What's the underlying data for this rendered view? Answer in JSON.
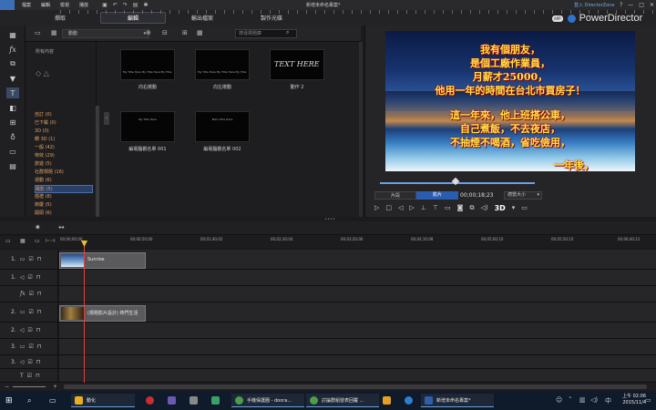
{
  "window": {
    "menu": [
      "檔案",
      "編輯",
      "檢視",
      "播放"
    ],
    "quick_icons": [
      "save-icon",
      "undo-icon",
      "redo-icon",
      "render-icon",
      "settings-icon"
    ],
    "document_title": "新增未命名專案*",
    "signin": "登入 DirectorZone",
    "controls": [
      "?",
      "—",
      "□",
      "✕"
    ]
  },
  "modes": {
    "capture": "擷取",
    "edit": "編輯",
    "produce": "輸出檔案",
    "disc": "製作光碟",
    "active": "edit"
  },
  "brand": {
    "app_badge": "APP",
    "name": "PowerDirector"
  },
  "toolstrip": [
    "media-room-icon",
    "fx-icon",
    "pip-icon",
    "particle-icon",
    "title-icon",
    "transition-icon",
    "audio-mix-icon",
    "voice-over-icon",
    "chapter-icon",
    "subtitle-icon"
  ],
  "library": {
    "filter": "動動",
    "search_placeholder": "搜尋標題庫",
    "tree_head": "所有內容",
    "categories": [
      {
        "label": "自訂 (0)"
      },
      {
        "label": "已下載 (0)"
      },
      {
        "label": "3D (0)"
      },
      {
        "label": "轉 3D (1)"
      },
      {
        "label": "一般 (42)"
      },
      {
        "label": "特效 (29)"
      },
      {
        "label": "旅遊 (5)"
      },
      {
        "label": "社群標題 (16)"
      },
      {
        "label": "運動 (6)"
      },
      {
        "label": "電影 (5)",
        "selected": true
      },
      {
        "label": "婚禮 (8)"
      },
      {
        "label": "節慶 (5)"
      },
      {
        "label": "開頭 (6)"
      }
    ],
    "thumbs": [
      {
        "label": "向右捲動",
        "caption": "My Title Here My Title Here My Title Here My"
      },
      {
        "label": "向左捲動",
        "caption": "My Title Here My Title Here My Title Here My"
      },
      {
        "label": "動作 2",
        "caption": "TEXT HERE"
      },
      {
        "label": "編電腦觀名單 001",
        "caption": "My Title Here"
      },
      {
        "label": "編電腦觀名單 002",
        "caption": "Main Title Here"
      }
    ]
  },
  "preview": {
    "lines": [
      "我有個朋友，",
      "是個工廠作業員，",
      "月薪才25000，",
      "他用一年的時間在台北市買房子！",
      "這一年來，他上班搭公車，",
      "自己煮飯，不去夜店，",
      "不抽煙不喝酒，省吃儉用，",
      "一年後，"
    ],
    "clip_label": "片段",
    "movie_label": "影片",
    "timecode": "00;00;18;23",
    "fit_label": "適當大小",
    "stereo_label": "3D"
  },
  "ruler": {
    "labels": [
      "00;00;00;00",
      "00;00;50;00",
      "00;01;40;02",
      "00;02;30;04",
      "00;03;20;06",
      "00;04;10;08",
      "00;05;00;10",
      "00;05;50;10",
      "00;06;40;12"
    ]
  },
  "tracks": [
    {
      "label": "1.",
      "kind": "video",
      "clip": "Sunrise"
    },
    {
      "label": "1.",
      "kind": "audio"
    },
    {
      "label": "fx",
      "kind": "fx"
    },
    {
      "label": "2.",
      "kind": "video",
      "clip": "(標題影片設計) 熱門生活"
    },
    {
      "label": "2.",
      "kind": "audio"
    },
    {
      "label": "3.",
      "kind": "video"
    },
    {
      "label": "3.",
      "kind": "audio"
    },
    {
      "label": "T",
      "kind": "title"
    }
  ],
  "taskbar": {
    "search_hint": "搜尋",
    "items": [
      {
        "label": "動化",
        "color": "#e8b020"
      },
      {
        "label": "手機保護圈 - doora...",
        "color": "#4a9f4a"
      },
      {
        "label": "討論群組發表回覆 ...",
        "color": "#4a9f4a"
      },
      {
        "label": "新增未命名專案*",
        "color": "#2f5fa8"
      }
    ],
    "time": "上午 02:06",
    "date": "2015/11/4"
  }
}
